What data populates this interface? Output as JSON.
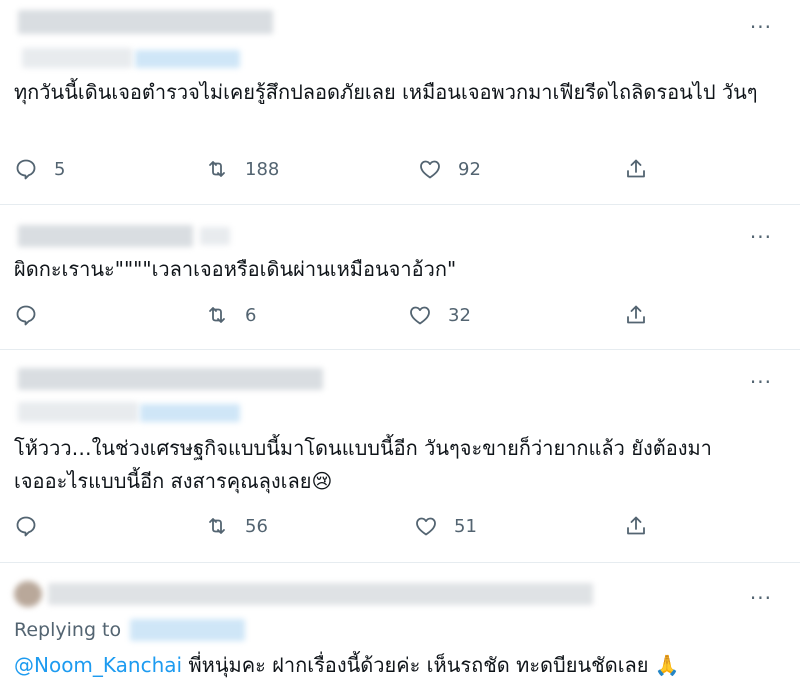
{
  "icons": {
    "more": "more-horizontal-icon",
    "reply": "reply-bubble-icon",
    "retweet": "retweet-icon",
    "like": "heart-icon",
    "share": "share-upload-icon",
    "emoji_sad": "crying-face-emoji",
    "emoji_pray": "folded-hands-emoji"
  },
  "colors": {
    "accent": "#1d9bf0",
    "muted": "#536471",
    "divider": "#e6ecf0"
  },
  "more_label": "···",
  "tweets": [
    {
      "text": "ทุกวันนี้เดินเจอตำรวจไม่เคยรู้สึกปลอดภัยเลย เหมือนเจอพวกมาเฟียรีดไถลิดรอนไป วันๆ",
      "replies": "5",
      "retweets": "188",
      "likes": "92"
    },
    {
      "text": "ผิดกะเรานะ\"\"\"\"เวลาเจอหรือเดินผ่านเหมือนจาอ้วก\"",
      "replies": "",
      "retweets": "6",
      "likes": "32"
    },
    {
      "text_line1": "โห้ววว…ในช่วงเศรษฐกิจแบบนี้มาโดนแบบนี้อีก วันๆจะขายก็ว่ายากแล้ว ยังต้องมา",
      "text_line2": "เจออะไรแบบนี้อีก  สงสารคุณลุงเลย",
      "emoji": "😢",
      "replies": "",
      "retweets": "56",
      "likes": "51"
    },
    {
      "replying_label": "Replying to",
      "mention": "@Noom_Kanchai",
      "text": "  พี่หนุ่มคะ ฝากเรื่องนี้ด้วยค่ะ เห็นรถชัด ทะดบียนชัดเลย",
      "emoji": "🙏"
    }
  ]
}
